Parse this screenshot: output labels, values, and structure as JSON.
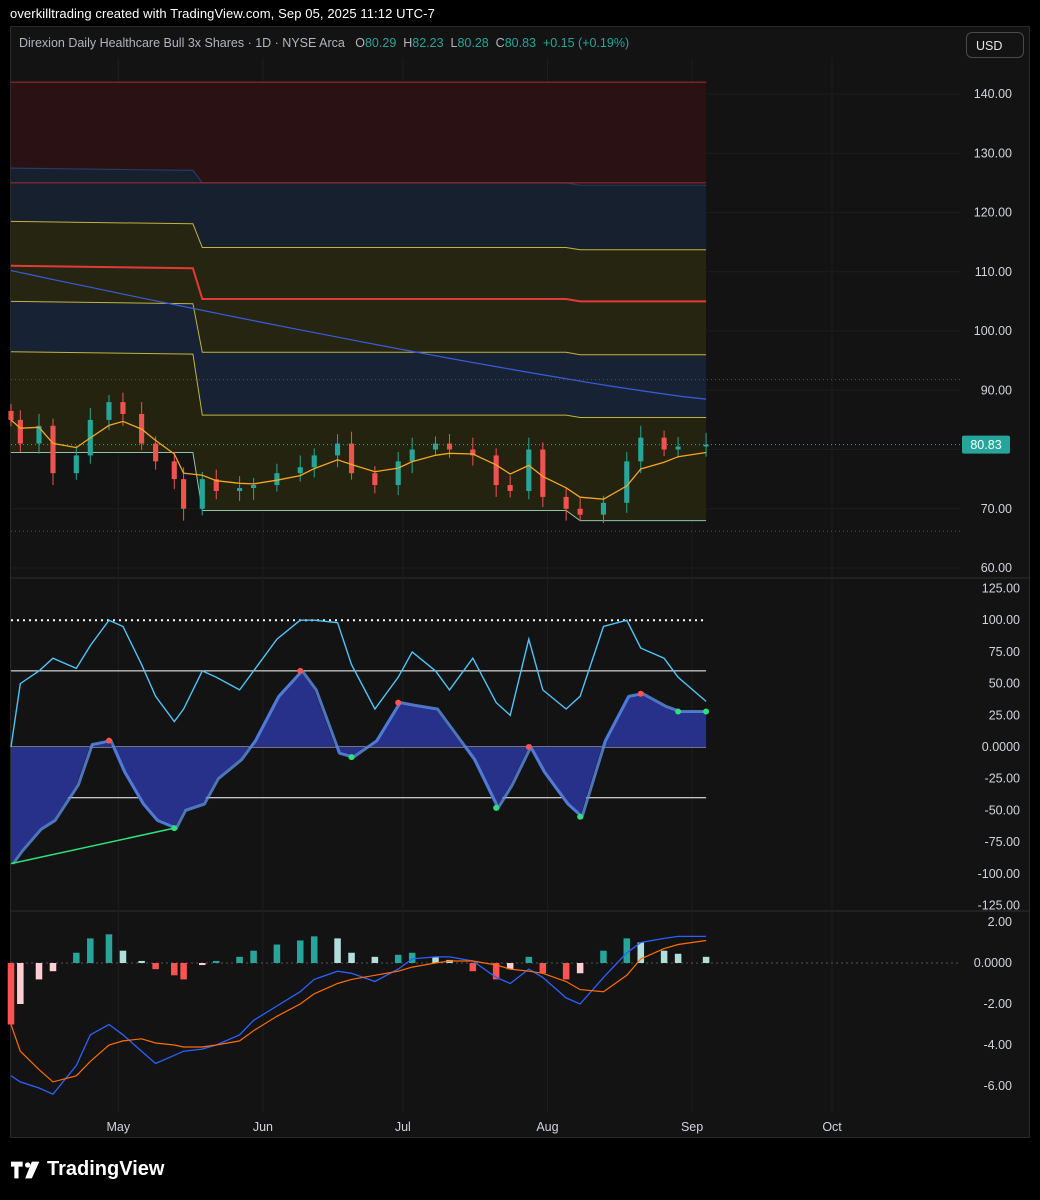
{
  "header": {
    "caption": "overkilltrading created with TradingView.com, Sep 05, 2025 11:12 UTC-7"
  },
  "legend": {
    "symbol": "Direxion Daily Healthcare Bull 3x Shares · 1D · NYSE Arca",
    "o_label": "O",
    "o_value": "80.29",
    "h_label": "H",
    "h_value": "82.23",
    "l_label": "L",
    "l_value": "80.28",
    "c_label": "C",
    "c_value": "80.83",
    "change": "+0.15 (+0.19%)"
  },
  "currency_button": "USD",
  "brand": {
    "name": "TradingView",
    "icon": "tradingview-logo-icon"
  },
  "colors": {
    "up": "#26a69a",
    "down": "#ef5350",
    "osc_line": "#4fc3f7",
    "wave_fill": "#27318a",
    "ema": "#f5a623",
    "ma_blue": "#3b5bdb",
    "macd_line": "#2962ff",
    "signal_line": "#ff6d00"
  },
  "chart_data": [
    {
      "type": "candlestick",
      "title": "Direxion Daily Healthcare Bull 3x Shares · 1D · NYSE Arca",
      "ylim": [
        60,
        145
      ],
      "y_ticks": [
        "140.00",
        "130.00",
        "120.00",
        "110.00",
        "100.00",
        "90.00",
        "70.00",
        "60.00"
      ],
      "last_price_label": "80.83",
      "x_labels": [
        "May",
        "Jun",
        "Jul",
        "Aug",
        "Sep",
        "Oct"
      ],
      "x_label_dates": [
        "2025-05-01",
        "2025-06-01",
        "2025-07-01",
        "2025-08-01",
        "2025-09-01",
        "2025-10-01"
      ],
      "x_range": [
        "2025-04-08",
        "2025-10-28"
      ],
      "close_series": {
        "dates": [
          "2025-04-08",
          "2025-04-10",
          "2025-04-14",
          "2025-04-17",
          "2025-04-22",
          "2025-04-25",
          "2025-04-29",
          "2025-05-02",
          "2025-05-06",
          "2025-05-09",
          "2025-05-13",
          "2025-05-15",
          "2025-05-19",
          "2025-05-22",
          "2025-05-27",
          "2025-05-30",
          "2025-06-04",
          "2025-06-09",
          "2025-06-12",
          "2025-06-17",
          "2025-06-20",
          "2025-06-25",
          "2025-06-30",
          "2025-07-03",
          "2025-07-08",
          "2025-07-11",
          "2025-07-16",
          "2025-07-21",
          "2025-07-24",
          "2025-07-28",
          "2025-07-31",
          "2025-08-05",
          "2025-08-08",
          "2025-08-13",
          "2025-08-18",
          "2025-08-21",
          "2025-08-26",
          "2025-08-29",
          "2025-09-04"
        ],
        "close": [
          85,
          81,
          84,
          76,
          79,
          85,
          88,
          86,
          81,
          78,
          75,
          70,
          75,
          73,
          73.5,
          74,
          76,
          77,
          79,
          81,
          76,
          74,
          78,
          80,
          81,
          80,
          79,
          74,
          73,
          80,
          72,
          70,
          69,
          71,
          78,
          82,
          80,
          80.5,
          80.83
        ]
      },
      "bands": [
        {
          "name": "red zone",
          "values": [
            142,
            125
          ]
        },
        {
          "name": "upper band",
          "values": [
            127.5,
            124.6
          ]
        },
        {
          "name": "band 2",
          "values": [
            118.5,
            113.7
          ]
        },
        {
          "name": "red line",
          "values": [
            111,
            105
          ]
        },
        {
          "name": "band 3",
          "values": [
            105,
            96
          ]
        },
        {
          "name": "band 4",
          "values": [
            96.5,
            85.4
          ]
        },
        {
          "name": "lower band",
          "values": [
            79.5,
            69.7,
            68
          ]
        }
      ],
      "long_ma": {
        "start": 110.2,
        "end": 88.5
      }
    },
    {
      "type": "line",
      "ylim": [
        -125,
        125
      ],
      "y_ticks": [
        "125.00",
        "100.00",
        "75.00",
        "50.00",
        "25.00",
        "0.0000",
        "-25.00",
        "-50.00",
        "-75.00",
        "-100.00",
        "-125.00"
      ],
      "levels": [
        100,
        60,
        0,
        -40
      ],
      "series": [
        {
          "values": [
            0,
            50,
            60,
            70,
            62,
            80,
            100,
            95,
            65,
            40,
            20,
            30,
            60,
            55,
            45,
            60,
            85,
            100,
            100,
            98,
            65,
            30,
            55,
            75,
            60,
            45,
            70,
            35,
            25,
            85,
            45,
            30,
            40,
            95,
            100,
            78,
            70,
            55,
            36
          ]
        },
        {
          "values": [
            -92,
            -82,
            -65,
            -58,
            -30,
            2,
            5,
            -20,
            -45,
            -58,
            -64,
            -50,
            -45,
            -25,
            -10,
            5,
            40,
            60,
            45,
            -5,
            -8,
            5,
            35,
            33,
            30,
            15,
            -10,
            -48,
            -30,
            0,
            -20,
            -45,
            -55,
            5,
            40,
            42,
            32,
            28,
            28
          ]
        }
      ]
    },
    {
      "type": "bar",
      "ylim": [
        -7,
        2
      ],
      "y_ticks": [
        "2.00",
        "0.0000",
        "-2.00",
        "-4.00",
        "-6.00"
      ],
      "series": [
        {
          "values": [
            -3,
            -2,
            -0.8,
            -0.4,
            0.5,
            1.2,
            1.4,
            0.6,
            0.1,
            -0.3,
            -0.6,
            -0.8,
            -0.1,
            0.1,
            0.3,
            0.6,
            0.9,
            1.1,
            1.3,
            1.2,
            0.5,
            0.3,
            0.4,
            0.5,
            0.3,
            0.15,
            -0.4,
            -0.8,
            -0.3,
            0.3,
            -0.5,
            -0.8,
            -0.5,
            0.6,
            1.2,
            1.0,
            0.6,
            0.45,
            0.3
          ]
        },
        {
          "values": [
            -5.5,
            -5.8,
            -6.1,
            -6.4,
            -5.0,
            -3.5,
            -3.0,
            -3.5,
            -4.3,
            -4.9,
            -4.5,
            -4.3,
            -4.2,
            -4.0,
            -3.5,
            -2.8,
            -2.1,
            -1.4,
            -0.8,
            -0.4,
            -0.5,
            -0.9,
            -0.3,
            0.2,
            0.3,
            0.3,
            0.1,
            -0.7,
            -1.0,
            -0.3,
            -0.7,
            -1.7,
            -2.0,
            -0.7,
            0.5,
            1.0,
            1.2,
            1.3,
            1.3
          ]
        },
        {
          "values": [
            -3.0,
            -4.3,
            -5.2,
            -5.8,
            -5.5,
            -4.8,
            -4.0,
            -3.8,
            -3.7,
            -3.9,
            -4.0,
            -4.1,
            -4.1,
            -4.0,
            -3.8,
            -3.3,
            -2.6,
            -2.0,
            -1.5,
            -1.0,
            -0.8,
            -0.6,
            -0.4,
            -0.2,
            0.0,
            0.1,
            0.1,
            -0.1,
            -0.3,
            -0.4,
            -0.5,
            -0.9,
            -1.3,
            -1.4,
            -0.6,
            0.2,
            0.7,
            0.9,
            1.1
          ]
        }
      ]
    }
  ]
}
